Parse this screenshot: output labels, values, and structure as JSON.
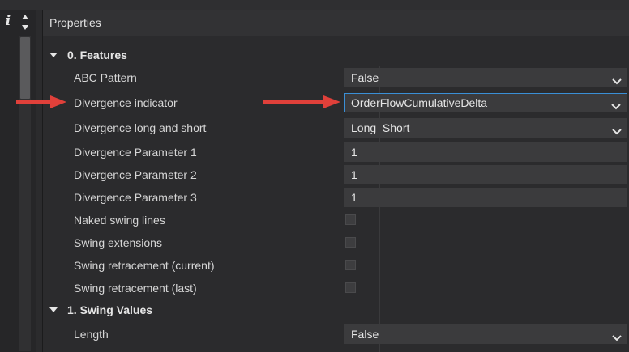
{
  "panel_title": "Properties",
  "toolbar": {
    "info_glyph": "i"
  },
  "categories": [
    {
      "label": "0. Features",
      "rows": [
        {
          "label": "ABC Pattern",
          "kind": "select",
          "value": "False"
        },
        {
          "label": "Divergence indicator",
          "kind": "select",
          "value": "OrderFlowCumulativeDelta",
          "active": true
        },
        {
          "label": "Divergence long and short",
          "kind": "select",
          "value": "Long_Short"
        },
        {
          "label": "Divergence Parameter 1",
          "kind": "text",
          "value": "1"
        },
        {
          "label": "Divergence Parameter 2",
          "kind": "text",
          "value": "1"
        },
        {
          "label": "Divergence Parameter 3",
          "kind": "text",
          "value": "1"
        },
        {
          "label": "Naked swing lines",
          "kind": "checkbox",
          "checked": false
        },
        {
          "label": "Swing extensions",
          "kind": "checkbox",
          "checked": false
        },
        {
          "label": "Swing retracement (current)",
          "kind": "checkbox",
          "checked": false
        },
        {
          "label": "Swing retracement (last)",
          "kind": "checkbox",
          "checked": false
        }
      ]
    },
    {
      "label": "1. Swing Values",
      "rows": [
        {
          "label": "Length",
          "kind": "select",
          "value": "False"
        }
      ]
    }
  ],
  "colors": {
    "accent_border": "#3a8fd6",
    "arrow": "#e0403a",
    "background": "#2b2b2d",
    "field": "#3b3b3d"
  }
}
